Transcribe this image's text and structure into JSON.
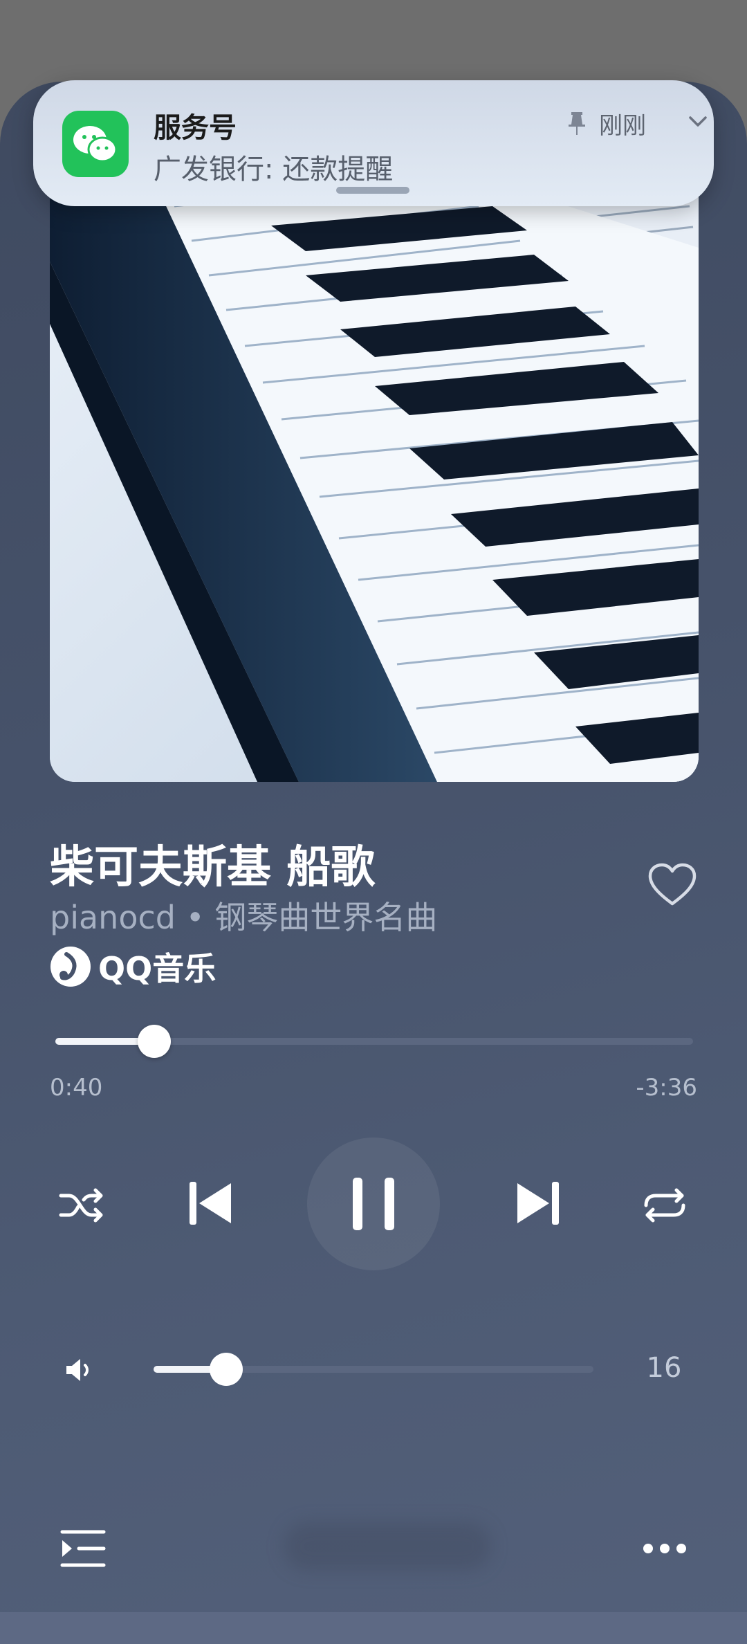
{
  "notification": {
    "title": "服务号",
    "body": "广发银行: 还款提醒",
    "time": "刚刚",
    "app_icon": "wechat-icon"
  },
  "song": {
    "title": "柴可夫斯基 船歌",
    "subtitle": "pianocd • 钢琴曲世界名曲",
    "source_label": "QQ音乐",
    "source_icon": "qq-music-icon"
  },
  "playback": {
    "elapsed": "0:40",
    "remaining": "-3:36",
    "progress_fraction": 0.155
  },
  "volume": {
    "value": "16",
    "fraction": 0.165
  },
  "colors": {
    "accent": "#ffffff",
    "notification_app": "#22c25a",
    "background": "#46526a"
  }
}
